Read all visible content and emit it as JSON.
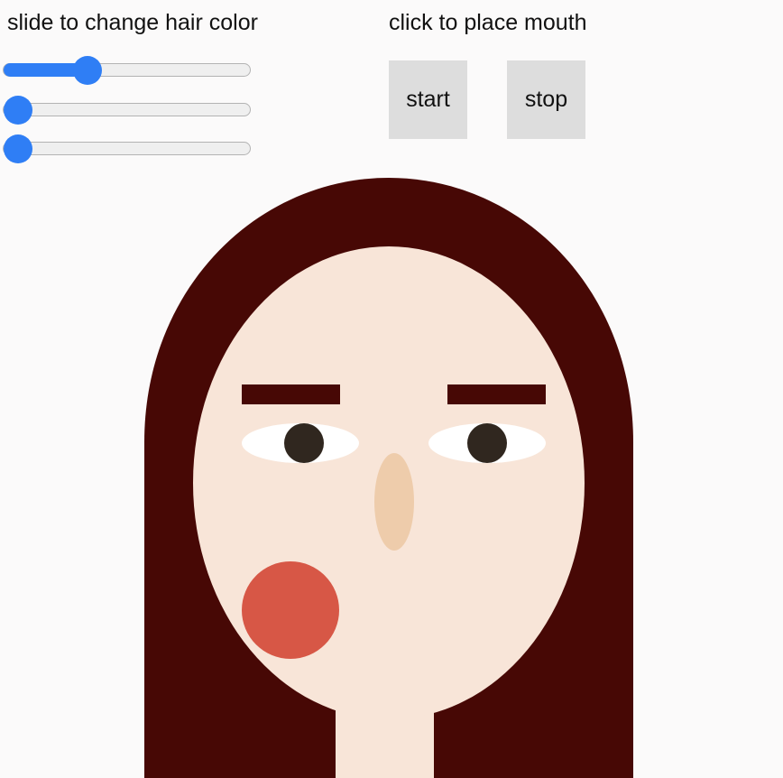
{
  "controls": {
    "hair_label": "slide to change hair color",
    "mouth_label": "click to place mouth",
    "start_label": "start",
    "stop_label": "stop",
    "sliders": [
      {
        "name": "hair-red-slider",
        "value": 0.32
      },
      {
        "name": "hair-green-slider",
        "value": 0.0
      },
      {
        "name": "hair-blue-slider",
        "value": 0.0
      }
    ]
  },
  "colors": {
    "background": "#fbfafa",
    "hair": "#470805",
    "skin": "#f8e5d8",
    "eye_white": "#ffffff",
    "iris": "#30271f",
    "nose": "#eeccab",
    "mouth": "#d75746",
    "slider_accent": "#2f7ef5",
    "button_bg": "#dddddd"
  }
}
